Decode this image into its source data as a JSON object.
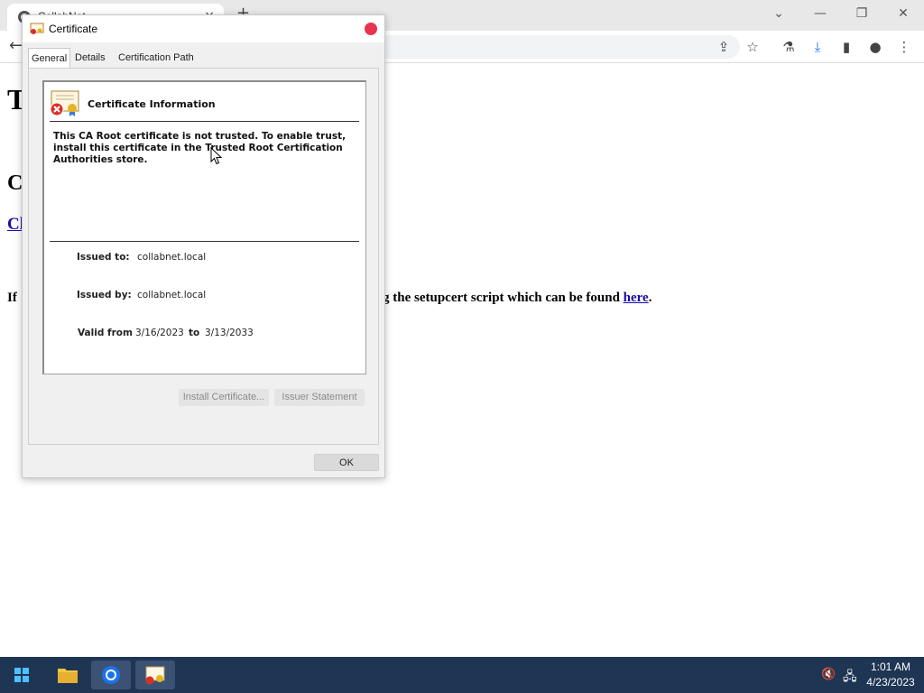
{
  "browser": {
    "tab_title": "CollabNet",
    "new_tab_glyph": "+",
    "tab_close_glyph": "×",
    "icons": [
      "back-arrow-icon",
      "share-icon",
      "star-icon",
      "labs-flask-icon",
      "download-icon",
      "side-panel-icon",
      "profile-icon",
      "more-menu-icon"
    ]
  },
  "window_controls": {
    "tab_search": "⌄",
    "minimize": "—",
    "restore": "❐",
    "close": "✕"
  },
  "page": {
    "heading_partial": "T",
    "subheading_partial": "C",
    "link_partial": "Cl",
    "para_start": "If",
    "para_tail": "g the setupcert script which can be found ",
    "para_link": "here",
    "para_end": "."
  },
  "dialog": {
    "title": "Certificate",
    "tabs": [
      {
        "label": "General",
        "active": true
      },
      {
        "label": "Details",
        "active": false
      },
      {
        "label": "Certification Path",
        "active": false
      }
    ],
    "info_heading": "Certificate Information",
    "warning_text": "This CA Root certificate is not trusted. To enable trust, install this certificate in the Trusted Root Certification Authorities store.",
    "issued_to_label": "Issued to:",
    "issued_to_value": "collabnet.local",
    "issued_by_label": "Issued by:",
    "issued_by_value": "collabnet.local",
    "valid_from_label": "Valid from",
    "valid_from_value": "3/16/2023",
    "valid_to_label": "to",
    "valid_to_value": "3/13/2033",
    "install_button": "Install Certificate...",
    "issuer_button": "Issuer Statement",
    "ok_button": "OK"
  },
  "taskbar": {
    "apps": [
      "start-icon",
      "file-explorer-icon",
      "chrome-icon",
      "certificate-app-icon"
    ],
    "time": "1:01 AM",
    "date": "4/23/2023"
  },
  "colors": {
    "close_dot": "#e8344e",
    "link": "#1a0dab",
    "taskbar": "#1f3554"
  }
}
